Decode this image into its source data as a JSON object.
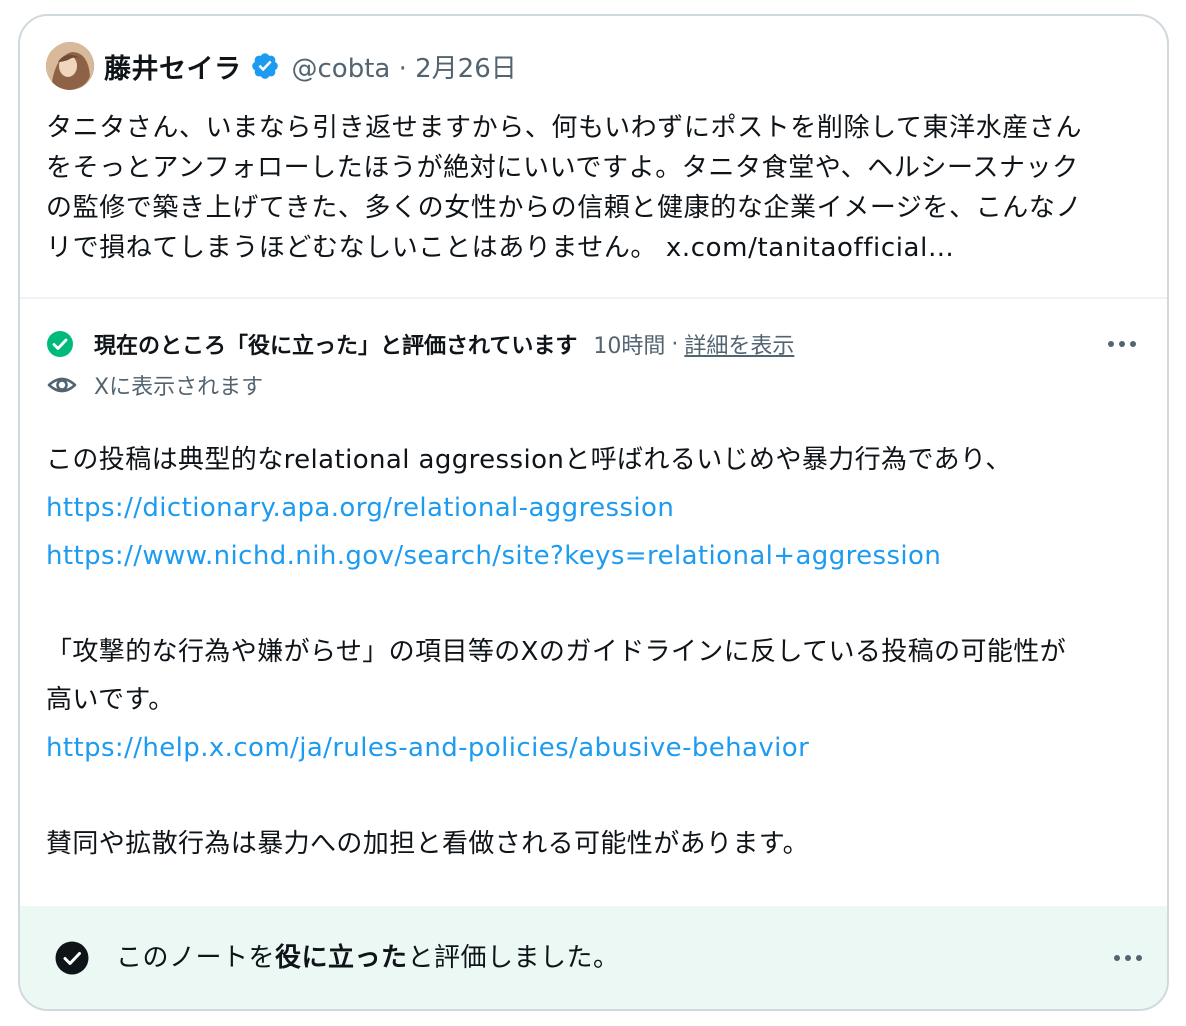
{
  "post": {
    "display_name": "藤井セイラ",
    "handle": "@cobta",
    "separator": "·",
    "date": "2月26日",
    "text_line1": "タニタさん、いまなら引き返せますから、何もいわずにポストを削除して東洋水産さん",
    "text_line2": "をそっとアンフォローしたほうが絶対にいいですよ。タニタ食堂や、ヘルシースナック",
    "text_line3": "の監修で築き上げてきた、多くの女性からの信頼と健康的な企業イメージを、こんなノ",
    "text_line4": "リで損ねてしまうほどむなしいことはありません。",
    "text_link": "x.com/tanitaofficial…"
  },
  "note": {
    "status": "現在のところ「役に立った」と評価されています",
    "time": "10時間",
    "separator": "·",
    "details_link": "詳細を表示",
    "visibility": "Xに表示されます",
    "body_line1": "この投稿は典型的なrelational aggressionと呼ばれるいじめや暴力行為であり、",
    "link1": "https://dictionary.apa.org/relational-aggression",
    "link2": "https://www.nichd.nih.gov/search/site?keys=relational+aggression",
    "body_line2": "「攻撃的な行為や嫌がらせ」の項目等のXのガイドラインに反している投稿の可能性が",
    "body_line3": "高いです。",
    "link3": "https://help.x.com/ja/rules-and-policies/abusive-behavior",
    "body_line4": "賛同や拡散行為は暴力への加担と看做される可能性があります。"
  },
  "footer": {
    "prefix": "このノートを",
    "bold": "役に立った",
    "suffix": "と評価しました。"
  },
  "colors": {
    "link_blue": "#1d9bf0",
    "verified_blue": "#1d9bf0",
    "helpful_green": "#00ba7c",
    "footer_bg": "#ebf8f3",
    "muted_gray": "#536471"
  },
  "icons": {
    "verified": "verified-badge-icon",
    "status": "check-circle-green-icon",
    "visibility": "eye-icon",
    "more": "more-horizontal-icon",
    "rated": "check-circle-black-icon"
  }
}
